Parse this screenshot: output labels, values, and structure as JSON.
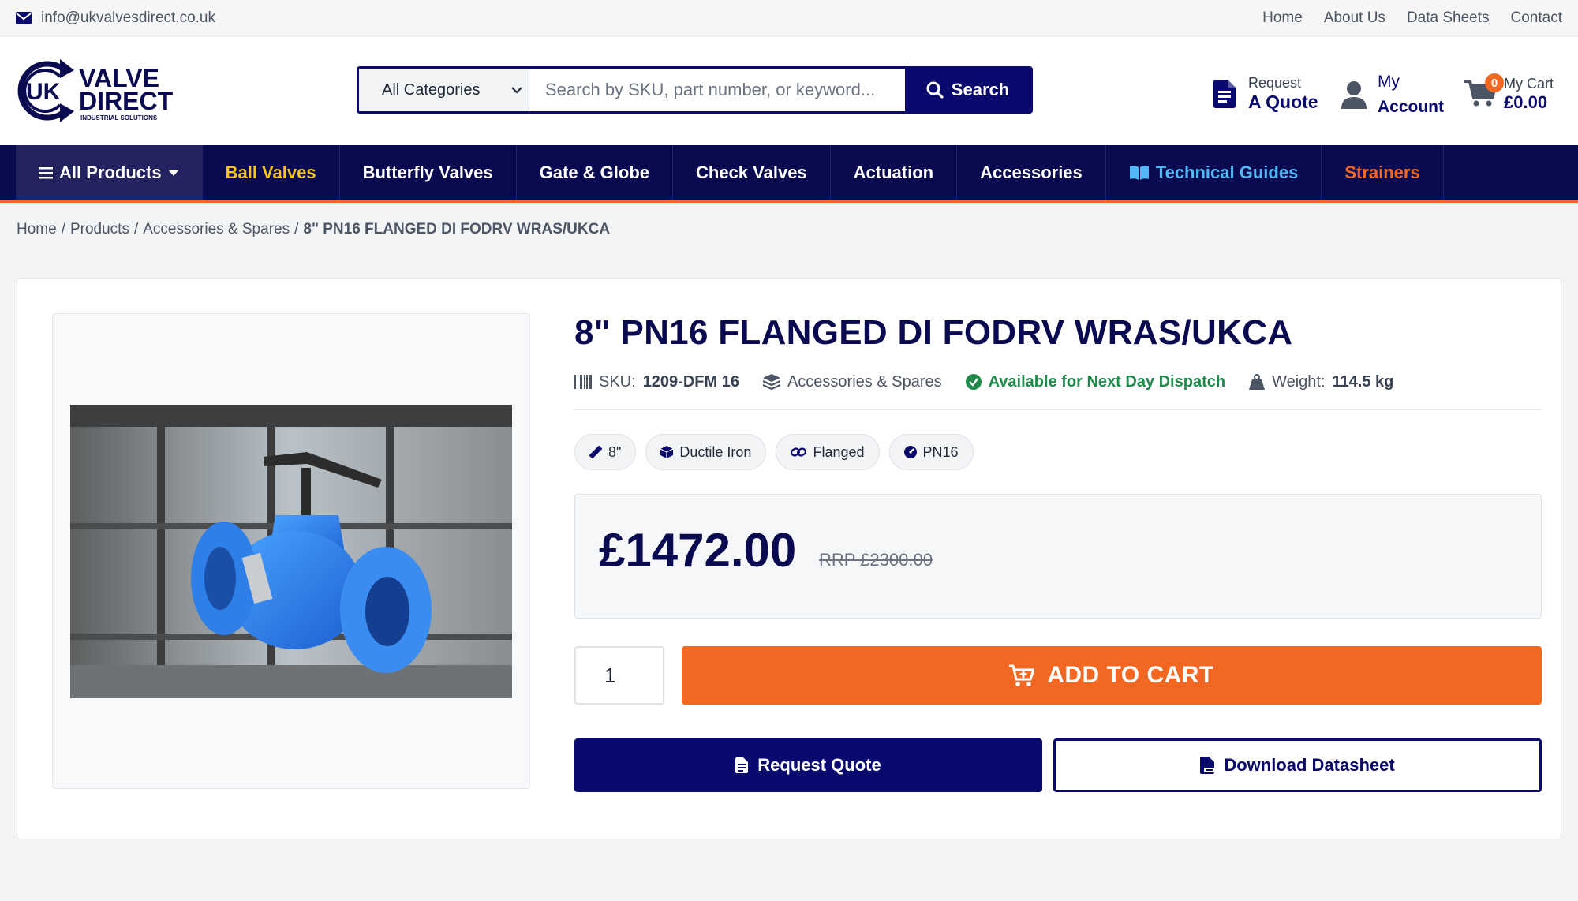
{
  "topbar": {
    "email": "info@ukvalvesdirect.co.uk",
    "links": [
      "Home",
      "About Us",
      "Data Sheets",
      "Contact"
    ]
  },
  "header": {
    "logo": {
      "line1": "UK",
      "line2": "VALVE",
      "line3": "DIRECT",
      "tagline": "INDUSTRIAL SOLUTIONS"
    },
    "search": {
      "category": "All Categories",
      "placeholder": "Search by SKU, part number, or keyword...",
      "button": "Search"
    },
    "quote": {
      "small": "Request",
      "big": "A Quote"
    },
    "account": {
      "line1": "My",
      "line2": "Account"
    },
    "cart": {
      "count": "0",
      "label": "My Cart",
      "total": "£0.00"
    }
  },
  "nav": {
    "items": [
      {
        "label": "All Products",
        "color": "#ffffff"
      },
      {
        "label": "Ball Valves",
        "color": "#f7c51e"
      },
      {
        "label": "Butterfly Valves",
        "color": "#ffffff"
      },
      {
        "label": "Gate & Globe",
        "color": "#ffffff"
      },
      {
        "label": "Check Valves",
        "color": "#ffffff"
      },
      {
        "label": "Actuation",
        "color": "#ffffff"
      },
      {
        "label": "Accessories",
        "color": "#ffffff"
      },
      {
        "label": "Technical Guides",
        "color": "#52b8f5"
      },
      {
        "label": "Strainers",
        "color": "#f26722"
      }
    ]
  },
  "breadcrumb": {
    "items": [
      "Home",
      "Products",
      "Accessories & Spares"
    ],
    "separator": "/",
    "current": "8\" PN16 FLANGED DI FODRV WRAS/UKCA"
  },
  "product": {
    "title": "8\" PN16 FLANGED DI FODRV WRAS/UKCA",
    "sku_label": "SKU:",
    "sku": "1209-DFM 16",
    "category": "Accessories & Spares",
    "availability": "Available for Next Day Dispatch",
    "weight_label": "Weight:",
    "weight": "114.5 kg",
    "tags": [
      "8\"",
      "Ductile Iron",
      "Flanged",
      "PN16"
    ],
    "price": "£1472.00",
    "rrp": "RRP £2300.00",
    "quantity": "1",
    "add_to_cart": "ADD TO CART",
    "request_quote": "Request Quote",
    "download_datasheet": "Download Datasheet"
  },
  "colors": {
    "navy": "#0a0a50",
    "brand_blue": "#0a0a6e",
    "accent_orange": "#f26722",
    "success_green": "#1f8a4c",
    "nav_yellow": "#f7c51e",
    "nav_light_blue": "#52b8f5"
  }
}
